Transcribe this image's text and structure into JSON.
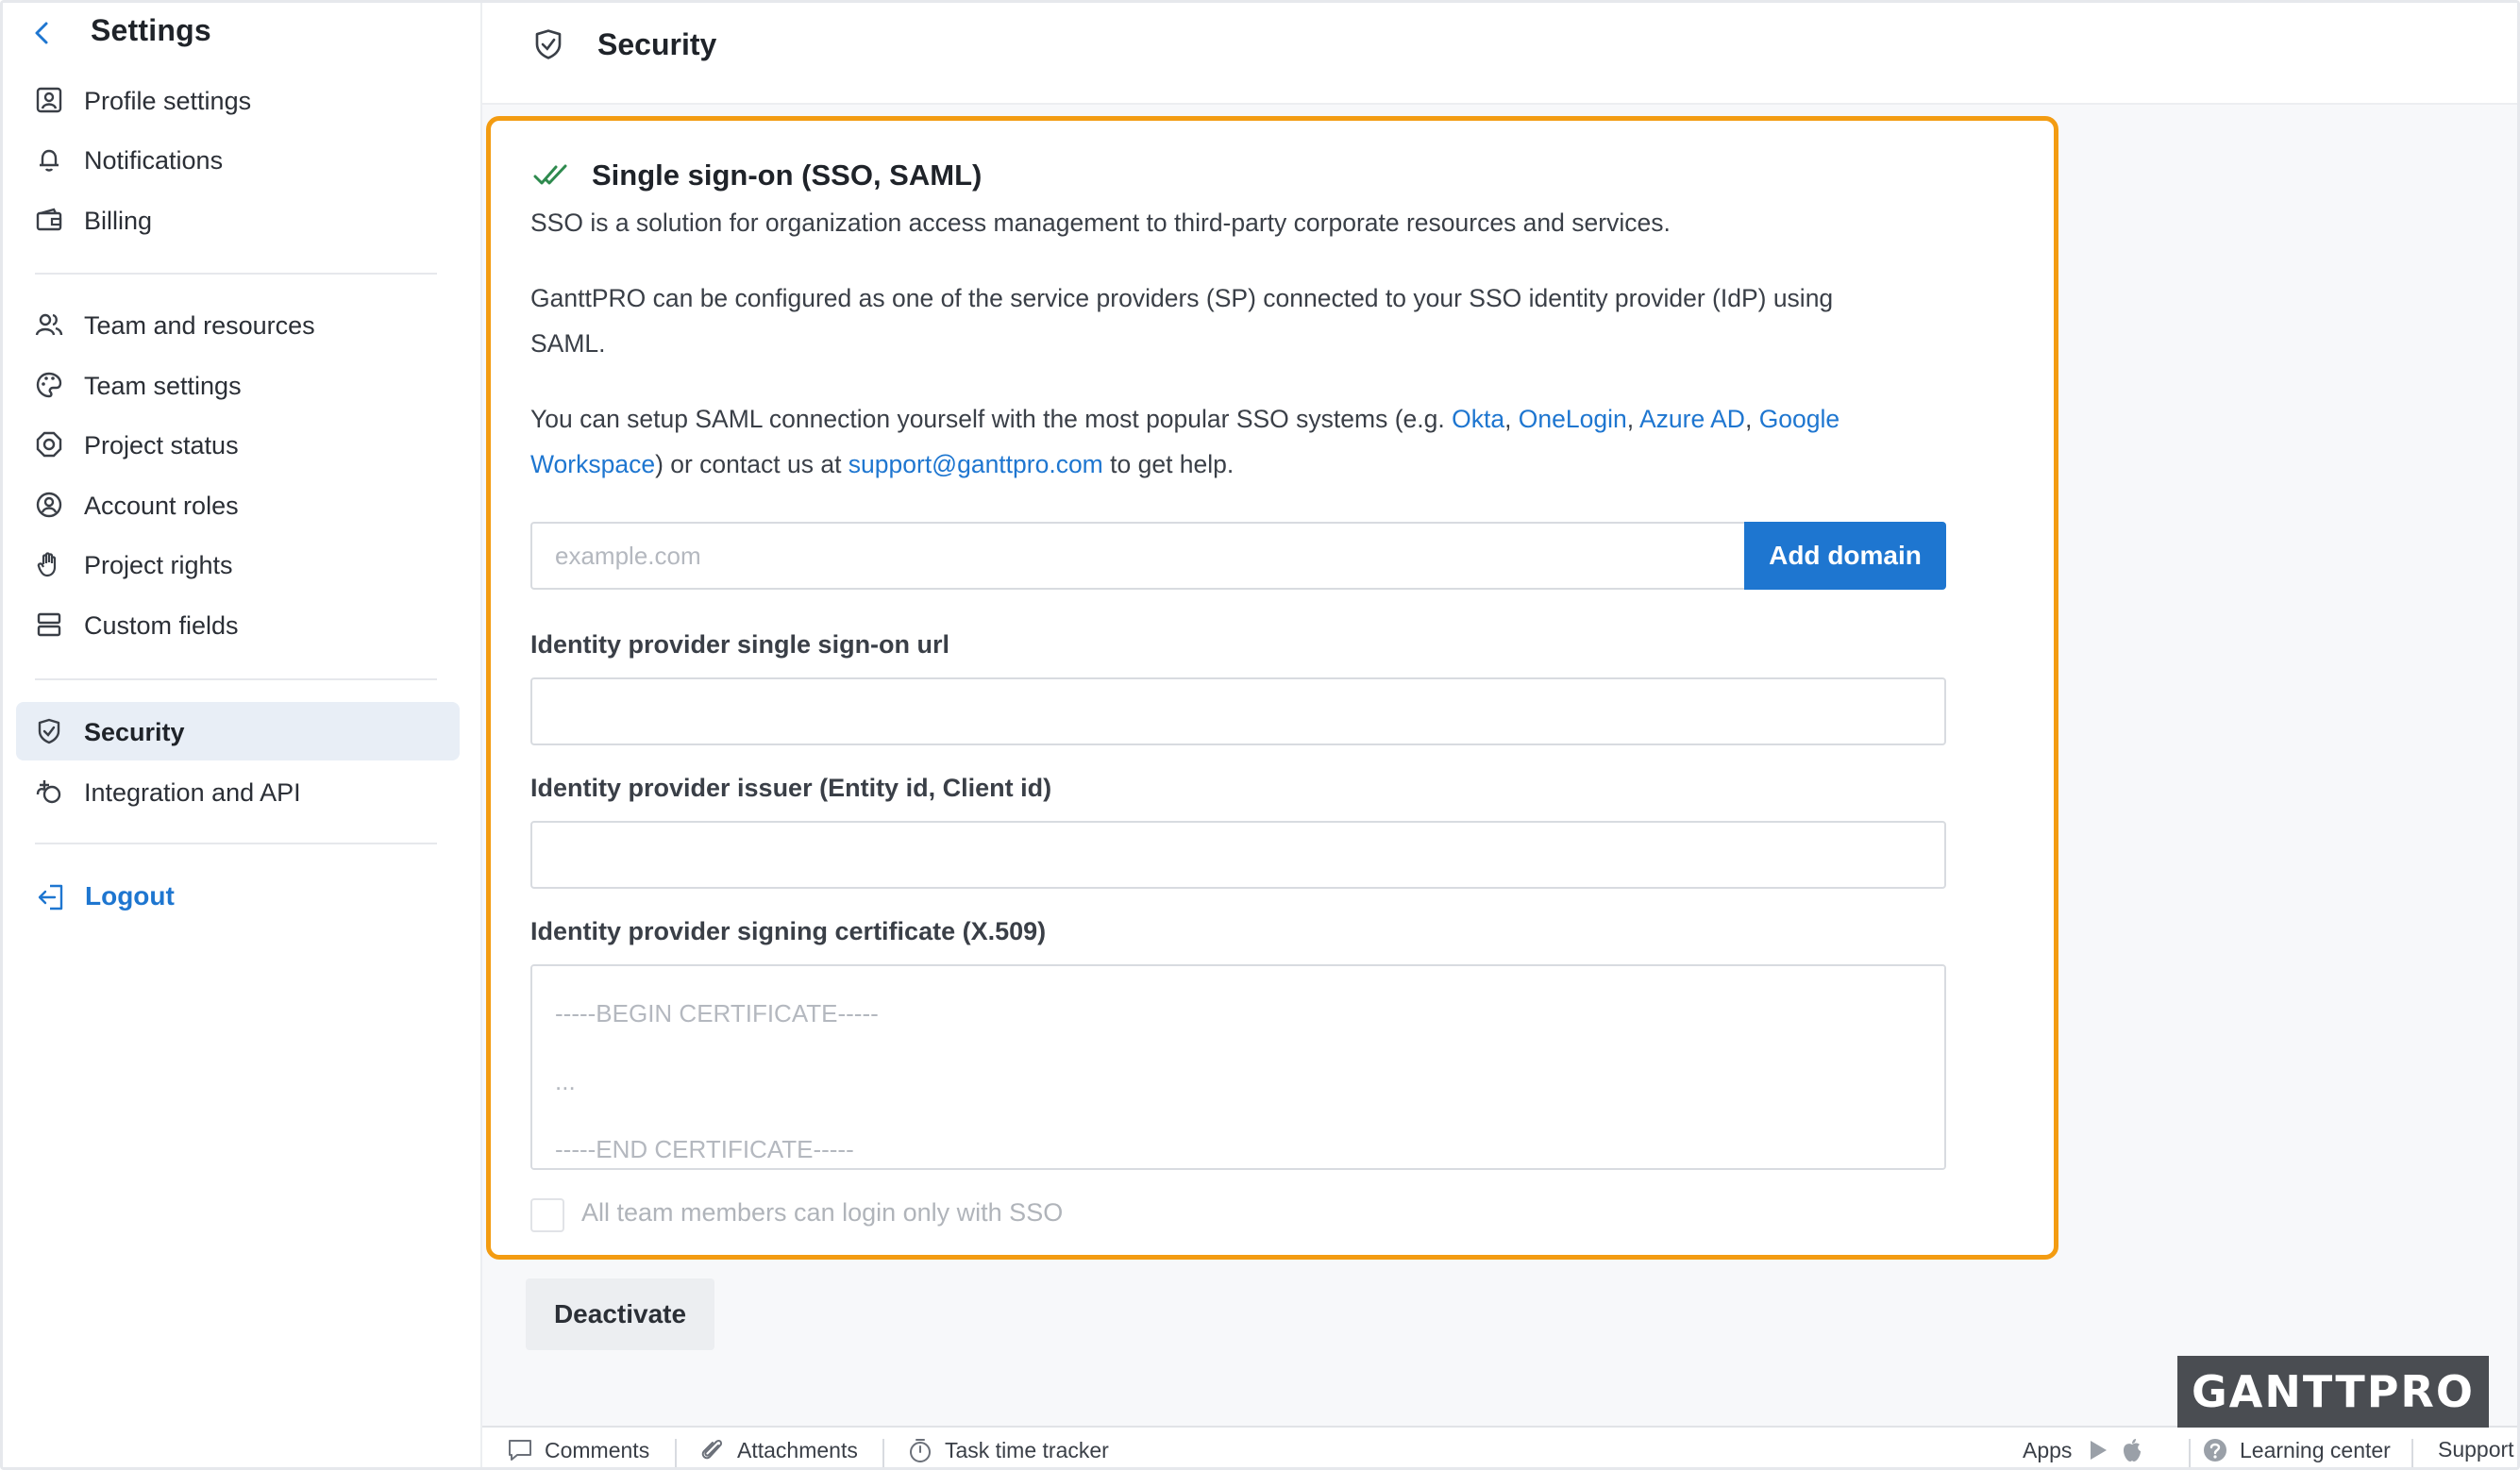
{
  "sidebar": {
    "title": "Settings",
    "groups": [
      [
        {
          "label": "Profile settings",
          "icon": "profile-icon"
        },
        {
          "label": "Notifications",
          "icon": "bell-icon"
        },
        {
          "label": "Billing",
          "icon": "wallet-icon"
        }
      ],
      [
        {
          "label": "Team and resources",
          "icon": "users-icon"
        },
        {
          "label": "Team settings",
          "icon": "palette-icon"
        },
        {
          "label": "Project status",
          "icon": "status-icon"
        },
        {
          "label": "Account roles",
          "icon": "account-role-icon"
        },
        {
          "label": "Project rights",
          "icon": "hand-icon"
        },
        {
          "label": "Custom fields",
          "icon": "fields-icon"
        }
      ],
      [
        {
          "label": "Security",
          "icon": "shield-icon",
          "active": true
        },
        {
          "label": "Integration and API",
          "icon": "integration-icon"
        }
      ]
    ],
    "logout_label": "Logout"
  },
  "header": {
    "title": "Security"
  },
  "sso": {
    "title": "Single sign-on (SSO, SAML)",
    "description": "SSO is a solution for organization access management to third-party corporate resources and services.",
    "configured_line1": "GanttPRO can be configured as one of the service providers (SP) connected to your SSO identity provider (IdP) using",
    "configured_line2": "SAML.",
    "setup_prefix": "You can setup SAML connection yourself with the most popular SSO systems (e.g. ",
    "links": {
      "okta": "Okta",
      "onelogin": "OneLogin",
      "azure": "Azure AD",
      "google_part1": "Google",
      "google_part2": "Workspace",
      "email": "support@ganttpro.com"
    },
    "setup_middle": ") or contact us at ",
    "setup_suffix": " to get help.",
    "domain_input": {
      "placeholder": "example.com",
      "value": ""
    },
    "add_domain_label": "Add domain",
    "sso_url_label": "Identity provider single sign-on url",
    "sso_url_value": "",
    "issuer_label": "Identity provider issuer (Entity id, Client id)",
    "issuer_value": "",
    "cert_label": "Identity provider signing certificate (X.509)",
    "cert_placeholder": "-----BEGIN CERTIFICATE-----\n...\n-----END CERTIFICATE-----",
    "sso_only_label": "All team members can login only with SSO",
    "sso_only_checked": false
  },
  "deactivate_label": "Deactivate",
  "bottombar": {
    "comments": "Comments",
    "attachments": "Attachments",
    "time_tracker": "Task time tracker",
    "apps": "Apps",
    "learning": "Learning center",
    "support": "Support"
  },
  "watermark": "GANTTPRO",
  "colors": {
    "accent": "#1e76d0",
    "highlight": "#f39c12",
    "active_bg": "#e8eef6"
  }
}
